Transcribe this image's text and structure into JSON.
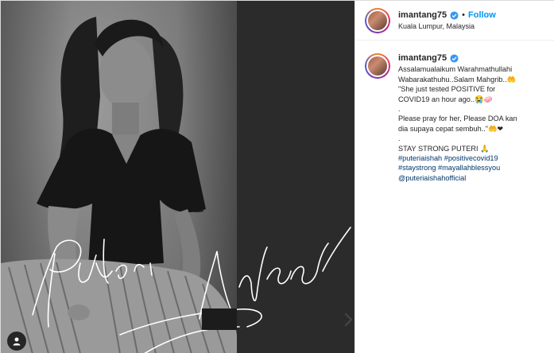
{
  "post": {
    "media": {
      "signature_text": "Puteri Aishah"
    },
    "header": {
      "username": "imantang75",
      "follow_separator": "•",
      "follow_label": "Follow",
      "location": "Kuala Lumpur, Malaysia"
    },
    "caption": {
      "username": "imantang75",
      "lines": [
        "Assalamualaikum Warahmathullahi",
        "Wabarakathuhu..Salam Mahgrib..🤲",
        "\"She just tested POSITIVE for",
        "COVID19 an hour ago..😭🧼",
        ".",
        "Please pray for her, Please DOA kan",
        "dia supaya cepat sembuh..\"🤲❤",
        ".",
        "STAY STRONG PUTERI 🙏"
      ],
      "hashtags": [
        "#puteriaishah #positivecovid19",
        "#staystrong #mayallahblessyou",
        "@puteriaishahofficial"
      ]
    }
  }
}
